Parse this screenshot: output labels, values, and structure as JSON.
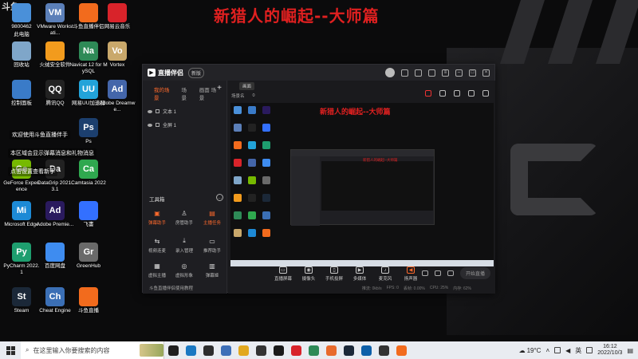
{
  "desktop": {
    "title": "新猎人的崛起--大师篇",
    "watermark": "斗鱼",
    "icons": [
      {
        "label": "此电脑",
        "sub": "9800462",
        "icon": "computer-icon",
        "color": "#4a90d9"
      },
      {
        "label": "VMware Workstati...",
        "icon": "vmware-icon",
        "color": "#5b7fb8"
      },
      {
        "label": "斗鱼直播伴侣",
        "icon": "douyu-companion-icon",
        "color": "#f26b1d"
      },
      {
        "label": "网易云音乐",
        "icon": "netease-music-icon",
        "color": "#d8232a"
      },
      {
        "label": "回收站",
        "icon": "recycle-bin-icon",
        "color": "#7fa6c9"
      },
      {
        "label": "火绒安全软件",
        "icon": "huorong-icon",
        "color": "#f29b1d"
      },
      {
        "label": "Navicat 12 for MySQL",
        "icon": "navicat-icon",
        "color": "#2e8a57"
      },
      {
        "label": "Vortex",
        "icon": "vortex-icon",
        "color": "#c9a86b"
      },
      {
        "label": "控制面板",
        "icon": "control-panel-icon",
        "color": "#3a7bc8"
      },
      {
        "label": "腾讯QQ",
        "icon": "qq-icon",
        "color": "#222222"
      },
      {
        "label": "网易UU加速器",
        "icon": "uu-icon",
        "color": "#22a3d9"
      },
      {
        "label": "Adobe Dreamwe...",
        "icon": "dreamweaver-icon",
        "color": "#46a"
      },
      {
        "label": "Ps",
        "icon": "photoshop-icon",
        "color": "#1c3f6e"
      },
      {
        "label": "GeForce Experience",
        "icon": "geforce-icon",
        "color": "#76b900"
      },
      {
        "label": "DataGrip 2021.3.1",
        "icon": "datagrip-icon",
        "color": "#222222"
      },
      {
        "label": "Camtasia 2022",
        "icon": "camtasia-icon",
        "color": "#2fa84f"
      },
      {
        "label": "Microsoft Edge",
        "icon": "edge-icon",
        "color": "#1d8ad6"
      },
      {
        "label": "Adobe Premie...",
        "icon": "premiere-icon",
        "color": "#2a1a5e"
      },
      {
        "label": "飞書",
        "icon": "feishu-icon",
        "color": "#3370ff"
      },
      {
        "label": "PyCharm 2022.1",
        "icon": "pycharm-icon",
        "color": "#1e9e6f"
      },
      {
        "label": "百度网盘",
        "icon": "baidu-netdisk-icon",
        "color": "#3e8cf0"
      },
      {
        "label": "GreenHub",
        "icon": "greenhub-icon",
        "color": "#6a6a6a"
      },
      {
        "label": "Steam",
        "icon": "steam-icon",
        "color": "#1b2838"
      },
      {
        "label": "Cheat Engine",
        "icon": "cheat-engine-icon",
        "color": "#3b6fb5"
      },
      {
        "label": "斗鱼直播",
        "icon": "douyu-icon",
        "color": "#f26b1d"
      }
    ],
    "notices": [
      "欢迎使用斗鱼直播伴手",
      "本区域会显示弹幕消息和礼物消息",
      "点击设置查看新手"
    ]
  },
  "app": {
    "name": "直播伴侣",
    "badge": "新版",
    "left_tabs": [
      "我的场景",
      "场景",
      "画面 场景"
    ],
    "scenes": [
      "文本 1",
      "全屏 1"
    ],
    "toolbox_title": "工具箱",
    "tools": [
      "弹幕助手",
      "房管助手",
      "主播任务",
      "视频连麦",
      "录入管理",
      "推荐助手",
      "虚拟主播",
      "虚拟形象",
      "弹幕姬"
    ],
    "footer": "斗鱼直播伴侣使用教程",
    "top_tag": "画面",
    "second_row": [
      "场景名",
      "0"
    ],
    "controls": [
      "直播屏幕",
      "摄像头",
      "手机投屏",
      "多媒体",
      "麦克风",
      "扬声器"
    ],
    "start_button": "开始直播",
    "status": [
      "推流: 0kb/s",
      "FPS: 0",
      "丢帧: 0.00%",
      "CPU: 25%",
      "内存: 62%"
    ],
    "preview_title": "新猎人的崛起--大师篇"
  },
  "taskbar": {
    "search_placeholder": "在这里输入你要搜索的内容",
    "apps": [
      "#1f1f1f",
      "#1a78c2",
      "#2d2d2d",
      "#3d6fb8",
      "#e2a81e",
      "#333333",
      "#1a1a1a",
      "#d8232a",
      "#2e8a57",
      "#e86a2c",
      "#1b2838",
      "#0d5fa8",
      "#333",
      "#f26b1d"
    ],
    "weather": "19°C",
    "ime": "英",
    "time": "16:12",
    "date": "2022/10/3"
  }
}
